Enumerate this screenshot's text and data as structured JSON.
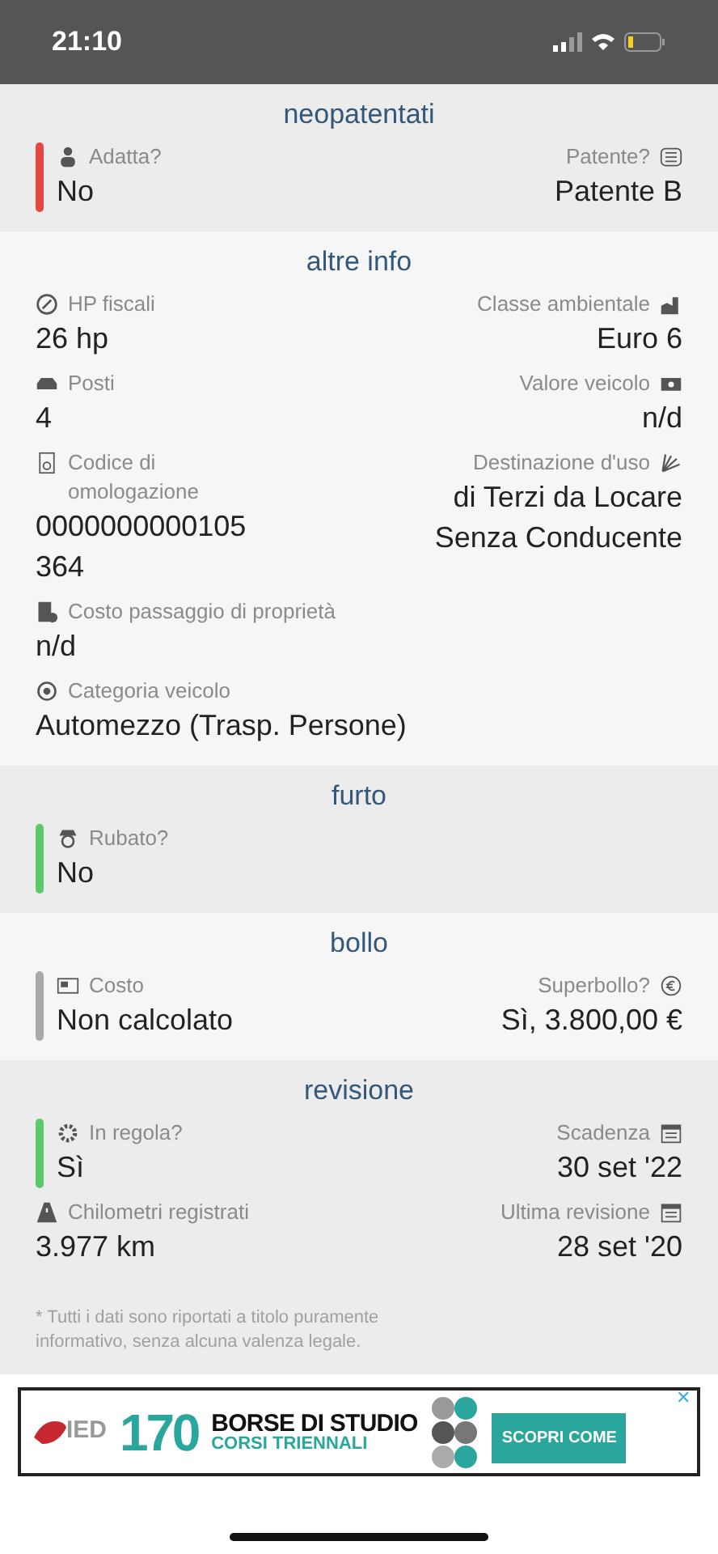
{
  "status_bar": {
    "time": "21:10"
  },
  "sections": [
    {
      "title": "neopatentati",
      "rows": [
        {
          "left": {
            "label": "Adatta?",
            "value": "No",
            "color": "#e5483e"
          },
          "right": {
            "label": "Patente?",
            "value": "Patente B"
          }
        }
      ]
    },
    {
      "title": "altre info",
      "rows": [
        {
          "left": {
            "label": "HP fiscali",
            "value": "26 hp"
          },
          "right": {
            "label": "Classe ambientale",
            "value": "Euro 6"
          }
        },
        {
          "left": {
            "label": "Posti",
            "value": "4"
          },
          "right": {
            "label": "Valore veicolo",
            "value": "n/d"
          }
        },
        {
          "left": {
            "label": "Codice di omologazione",
            "value": "0000000000105364"
          },
          "right": {
            "label": "Destinazione d'uso",
            "value": "di Terzi da Locare Senza Conducente"
          }
        },
        {
          "left": {
            "label": "Costo passaggio di proprietà",
            "value": "n/d"
          }
        },
        {
          "left": {
            "label": "Categoria veicolo",
            "value": "Automezzo (Trasp. Persone)"
          }
        }
      ]
    },
    {
      "title": "furto",
      "rows": [
        {
          "left": {
            "label": "Rubato?",
            "value": "No",
            "color": "#5cc96a"
          }
        }
      ]
    },
    {
      "title": "bollo",
      "rows": [
        {
          "left": {
            "label": "Costo",
            "value": "Non calcolato",
            "color": "#a9a9a9"
          },
          "right": {
            "label": "Superbollo?",
            "value": "Sì, 3.800,00 €"
          }
        }
      ]
    },
    {
      "title": "revisione",
      "rows": [
        {
          "left": {
            "label": "In regola?",
            "value": "Sì",
            "color": "#5cc96a"
          },
          "right": {
            "label": "Scadenza",
            "value": "30 set '22"
          }
        },
        {
          "left": {
            "label": "Chilometri registrati",
            "value": "3.977 km"
          },
          "right": {
            "label": "Ultima revisione",
            "value": "28 set '20"
          }
        }
      ]
    }
  ],
  "disclaimer": "* Tutti i dati sono riportati a titolo puramente informativo, senza alcuna valenza legale.",
  "ad": {
    "brand": "IED",
    "number": "170",
    "headline": "BORSE DI STUDIO",
    "subline": "CORSI TRIENNALI",
    "cta": "SCOPRI COME",
    "close": "✕"
  }
}
